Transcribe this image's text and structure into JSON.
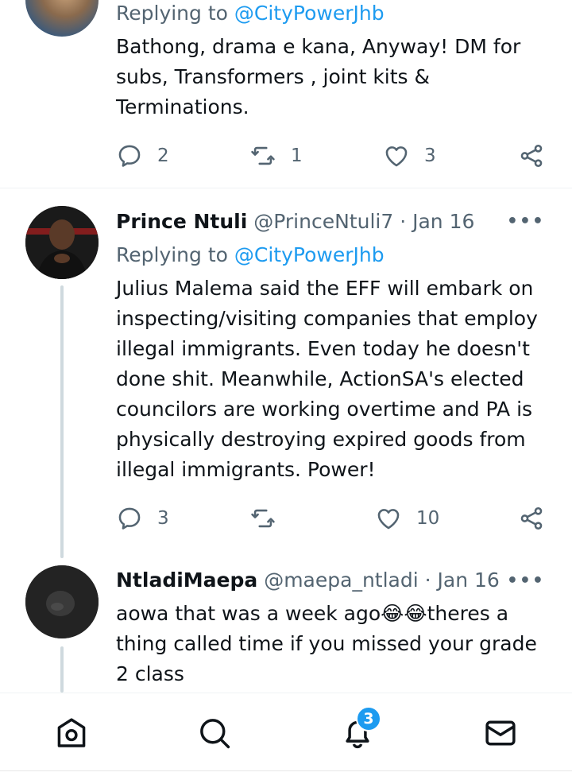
{
  "tweets": [
    {
      "replying_prefix": "Replying to ",
      "replying_mention": "@CityPowerJhb",
      "text": "Bathong, drama e kana, Anyway! DM for subs, Transformers , joint kits & Terminations.",
      "replies": "2",
      "retweets": "1",
      "likes": "3"
    },
    {
      "name": "Prince Ntuli",
      "handle": "@PrinceNtuli7",
      "dot": "·",
      "date": "Jan 16",
      "replying_prefix": "Replying to ",
      "replying_mention": "@CityPowerJhb",
      "text": "Julius Malema said the EFF will embark on inspecting/visiting companies that employ illegal immigrants. Even today he doesn't done shit. Meanwhile, ActionSA's elected councilors are working overtime and PA is physically destroying expired goods from illegal immigrants. Power!",
      "replies": "3",
      "retweets": "",
      "likes": "10"
    },
    {
      "name": "NtladiMaepa",
      "handle": "@maepa_ntladi",
      "dot": "·",
      "date": "Jan 16",
      "text_before": "aowa that was a week ago",
      "emoji": "😂😂",
      "text_after": "theres a thing called time if you missed your grade 2 class"
    }
  ],
  "more_glyph": "•••",
  "nav": {
    "notifications_badge": "3"
  },
  "colors": {
    "accent": "#1d9bf0",
    "secondary_text": "#536471",
    "thread_line": "#cfd9de"
  }
}
